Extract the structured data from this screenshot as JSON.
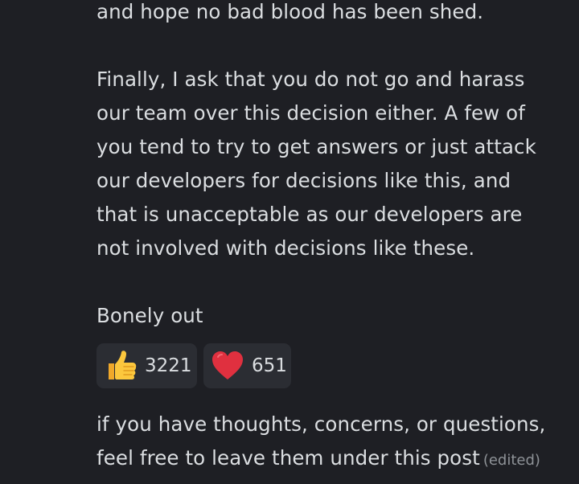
{
  "message": {
    "lines_top": [
      "and hope no bad blood has been shed."
    ],
    "paragraph_finally": [
      "Finally, I ask that you do not go and harass",
      "our team over this decision either. A few of",
      "you tend to try to get answers or just attack",
      "our developers for decisions like this, and",
      "that is unacceptable as our developers are",
      "not involved with decisions like these."
    ],
    "signoff": "Bonely out",
    "footer": [
      "if you have thoughts, concerns, or questions,",
      "feel free to leave them under this post"
    ],
    "edited_label": "(edited)"
  },
  "reactions": [
    {
      "emoji": "thumbs-up-icon",
      "count": "3221"
    },
    {
      "emoji": "red-heart-icon",
      "count": "651"
    }
  ],
  "colors": {
    "background": "#1e1f24",
    "text": "#dbdee1",
    "reaction_bg": "#2b2d33",
    "muted": "#8e9297",
    "heart": "#e0303f",
    "thumb": "#f8c23a"
  }
}
